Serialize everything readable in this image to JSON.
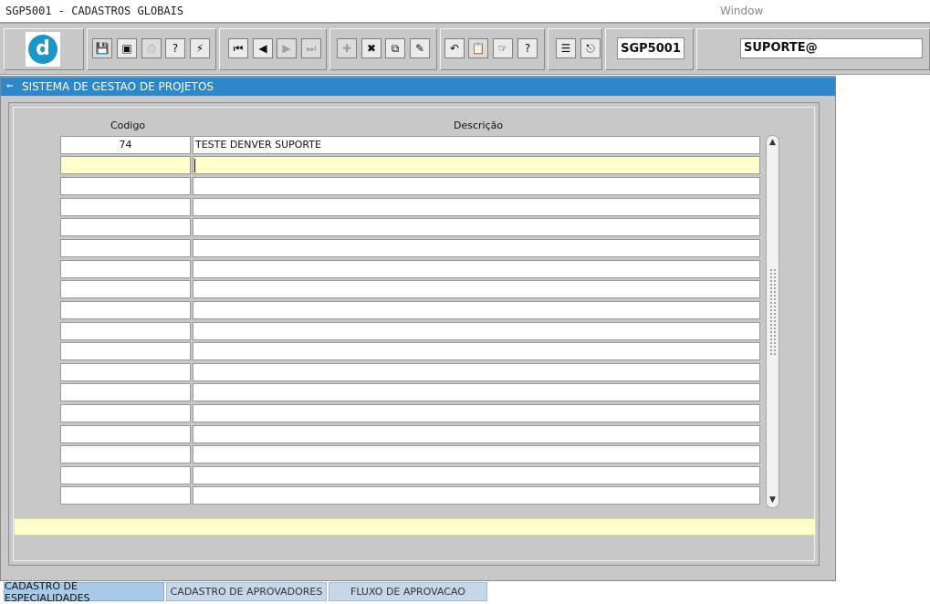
{
  "menubar": {
    "app_title": "SGP5001 - CADASTROS GLOBAIS",
    "menu_window": "Window"
  },
  "toolbar": {
    "logo_letter": "d",
    "form_code": "SGP5001",
    "user": "SUPORTE@",
    "buttons": [
      {
        "name": "save-icon",
        "glyph": "💾"
      },
      {
        "name": "window-icon",
        "glyph": "▣"
      },
      {
        "name": "print-icon",
        "glyph": "⎙"
      },
      {
        "name": "query-help-icon",
        "glyph": "?"
      },
      {
        "name": "execute-query-icon",
        "glyph": "⚡"
      },
      {
        "name": "first-record-icon",
        "glyph": "⏮"
      },
      {
        "name": "previous-record-icon",
        "glyph": "◀"
      },
      {
        "name": "next-record-icon",
        "glyph": "▶"
      },
      {
        "name": "last-record-icon",
        "glyph": "⏭"
      },
      {
        "name": "insert-record-icon",
        "glyph": "✚"
      },
      {
        "name": "delete-record-icon",
        "glyph": "✖"
      },
      {
        "name": "duplicate-record-icon",
        "glyph": "⧉"
      },
      {
        "name": "edit-icon",
        "glyph": "✎"
      },
      {
        "name": "undo-icon",
        "glyph": "↶"
      },
      {
        "name": "clipboard-icon",
        "glyph": "📋"
      },
      {
        "name": "list-values-icon",
        "glyph": "☞"
      },
      {
        "name": "help-icon",
        "glyph": "?"
      },
      {
        "name": "menu-icon",
        "glyph": "☰"
      },
      {
        "name": "exit-icon",
        "glyph": "⎋"
      }
    ]
  },
  "window": {
    "title": "SISTEMA DE GESTAO DE PROJETOS"
  },
  "grid": {
    "col_codigo": "Codigo",
    "col_descricao": "Descrição",
    "rows": [
      {
        "codigo": "74",
        "descricao": "TESTE DENVER SUPORTE"
      },
      {
        "codigo": "",
        "descricao": ""
      },
      {
        "codigo": "",
        "descricao": ""
      },
      {
        "codigo": "",
        "descricao": ""
      },
      {
        "codigo": "",
        "descricao": ""
      },
      {
        "codigo": "",
        "descricao": ""
      },
      {
        "codigo": "",
        "descricao": ""
      },
      {
        "codigo": "",
        "descricao": ""
      },
      {
        "codigo": "",
        "descricao": ""
      },
      {
        "codigo": "",
        "descricao": ""
      },
      {
        "codigo": "",
        "descricao": ""
      },
      {
        "codigo": "",
        "descricao": ""
      },
      {
        "codigo": "",
        "descricao": ""
      },
      {
        "codigo": "",
        "descricao": ""
      },
      {
        "codigo": "",
        "descricao": ""
      },
      {
        "codigo": "",
        "descricao": ""
      },
      {
        "codigo": "",
        "descricao": ""
      },
      {
        "codigo": "",
        "descricao": ""
      }
    ]
  },
  "tabs": [
    {
      "label": "CADASTRO DE ESPECIALIDADES",
      "active": true
    },
    {
      "label": "CADASTRO DE APROVADORES",
      "active": false
    },
    {
      "label": "FLUXO DE APROVACAO",
      "active": false
    }
  ],
  "colors": {
    "title_bar": "#2f87c9",
    "current_row": "#ffffcc",
    "form_background": "#c8c8c8"
  }
}
